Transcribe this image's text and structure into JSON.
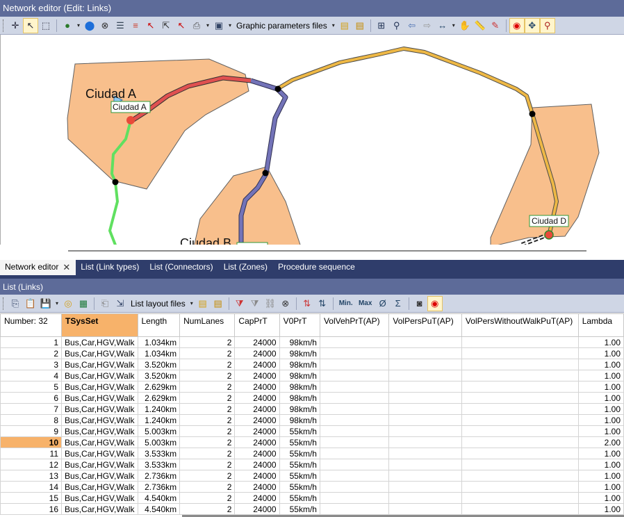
{
  "window": {
    "title": "Network editor (Edit: Links)"
  },
  "toolbar_top": {
    "items": [
      {
        "type": "grip"
      },
      {
        "type": "btn",
        "name": "cross-icon",
        "glyph": "✛"
      },
      {
        "type": "btn",
        "name": "pointer-icon",
        "glyph": "↖",
        "active": true
      },
      {
        "type": "btn",
        "name": "rect-select-icon",
        "glyph": "⬚"
      },
      {
        "type": "sep"
      },
      {
        "type": "btn",
        "name": "globe-icon",
        "glyph": "●",
        "color": "#2b7a2b"
      },
      {
        "type": "drop"
      },
      {
        "type": "btn",
        "name": "map-pin-icon",
        "glyph": "⬤",
        "color": "#1e6fd9"
      },
      {
        "type": "btn",
        "name": "binoculars-icon",
        "glyph": "⊗",
        "color": "#333"
      },
      {
        "type": "btn",
        "name": "list-icon",
        "glyph": "☰",
        "color": "#345"
      },
      {
        "type": "btn",
        "name": "layers-icon",
        "glyph": "≡",
        "color": "#c43"
      },
      {
        "type": "btn",
        "name": "select-red-icon",
        "glyph": "↖",
        "color": "#c00"
      },
      {
        "type": "btn",
        "name": "select-multi-icon",
        "glyph": "⇱",
        "color": "#333"
      },
      {
        "type": "btn",
        "name": "select-path-icon",
        "glyph": "↖",
        "color": "#c00"
      },
      {
        "type": "btn",
        "name": "printer-icon",
        "glyph": "⎙",
        "color": "#555"
      },
      {
        "type": "drop"
      },
      {
        "type": "btn",
        "name": "graphic-params-icon",
        "glyph": "▣",
        "color": "#346"
      },
      {
        "type": "drop"
      },
      {
        "type": "label",
        "bind": "toolbar_top.graphic_params_label"
      },
      {
        "type": "drop"
      },
      {
        "type": "btn",
        "name": "open-folder-icon",
        "glyph": "▤",
        "color": "#d4a017"
      },
      {
        "type": "btn",
        "name": "save-folder-icon",
        "glyph": "▤",
        "color": "#c58a00"
      },
      {
        "type": "sep"
      },
      {
        "type": "btn",
        "name": "zoom-rect-icon",
        "glyph": "⊞",
        "color": "#235"
      },
      {
        "type": "btn",
        "name": "zoom-icon",
        "glyph": "⚲",
        "color": "#235"
      },
      {
        "type": "btn",
        "name": "back-arrow-icon",
        "glyph": "⇦",
        "color": "#4a6fb0"
      },
      {
        "type": "btn",
        "name": "forward-arrow-icon",
        "glyph": "⇨",
        "color": "#999"
      },
      {
        "type": "btn",
        "name": "fit-width-icon",
        "glyph": "↔",
        "color": "#246"
      },
      {
        "type": "drop"
      },
      {
        "type": "btn",
        "name": "hand-pan-icon",
        "glyph": "✋",
        "color": "#333"
      },
      {
        "type": "btn",
        "name": "ruler-icon",
        "glyph": "📏",
        "color": "#a66"
      },
      {
        "type": "btn",
        "name": "pencil-icon",
        "glyph": "✎",
        "color": "#c33"
      },
      {
        "type": "sep"
      },
      {
        "type": "btn",
        "name": "record-icon",
        "glyph": "◉",
        "color": "#d00",
        "active": true
      },
      {
        "type": "btn",
        "name": "network-view-icon",
        "glyph": "✥",
        "color": "#246",
        "active": true
      },
      {
        "type": "btn",
        "name": "zoom-map-icon",
        "glyph": "⚲",
        "color": "#a22",
        "active": true
      }
    ],
    "graphic_params_label": "Graphic parameters files"
  },
  "map": {
    "labels": {
      "zone_a": "Ciudad A",
      "node_a": "Ciudad A",
      "zone_b": "Ciudad B",
      "node_d": "Ciudad D"
    },
    "colors": {
      "zone_fill": "#f8bf8c",
      "zone_stroke": "#606060",
      "link_blue": "#7373b8",
      "link_yellow": "#eeb845",
      "link_green": "#60e060",
      "link_red": "#e05050"
    }
  },
  "tabs": [
    {
      "label": "Network editor",
      "active": true,
      "closable": true
    },
    {
      "label": "List (Link types)"
    },
    {
      "label": "List (Connectors)"
    },
    {
      "label": "List (Zones)"
    },
    {
      "label": "Procedure sequence"
    }
  ],
  "list": {
    "title": "List (Links)",
    "layout_files_label": "List layout files",
    "columns": [
      {
        "label": "Number: 32",
        "width": 89
      },
      {
        "label": "TSysSet",
        "width": 100,
        "selected": true
      },
      {
        "label": "Length",
        "width": 61
      },
      {
        "label": "NumLanes",
        "width": 80
      },
      {
        "label": "CapPrT",
        "width": 65
      },
      {
        "label": "V0PrT",
        "width": 59
      },
      {
        "label": "VolVehPrT(AP)",
        "width": 100
      },
      {
        "label": "VolPersPuT(AP)",
        "width": 105
      },
      {
        "label": "VolPersWithoutWalkPuT(AP)",
        "width": 168
      },
      {
        "label": "Lambda",
        "width": 66
      }
    ],
    "rows": [
      {
        "num": "1",
        "tsys": "Bus,Car,HGV,Walk",
        "length": "1.034km",
        "lanes": "2",
        "cap": "24000",
        "v0": "98km/h",
        "lambda": "1.00"
      },
      {
        "num": "2",
        "tsys": "Bus,Car,HGV,Walk",
        "length": "1.034km",
        "lanes": "2",
        "cap": "24000",
        "v0": "98km/h",
        "lambda": "1.00"
      },
      {
        "num": "3",
        "tsys": "Bus,Car,HGV,Walk",
        "length": "3.520km",
        "lanes": "2",
        "cap": "24000",
        "v0": "98km/h",
        "lambda": "1.00"
      },
      {
        "num": "4",
        "tsys": "Bus,Car,HGV,Walk",
        "length": "3.520km",
        "lanes": "2",
        "cap": "24000",
        "v0": "98km/h",
        "lambda": "1.00"
      },
      {
        "num": "5",
        "tsys": "Bus,Car,HGV,Walk",
        "length": "2.629km",
        "lanes": "2",
        "cap": "24000",
        "v0": "98km/h",
        "lambda": "1.00"
      },
      {
        "num": "6",
        "tsys": "Bus,Car,HGV,Walk",
        "length": "2.629km",
        "lanes": "2",
        "cap": "24000",
        "v0": "98km/h",
        "lambda": "1.00"
      },
      {
        "num": "7",
        "tsys": "Bus,Car,HGV,Walk",
        "length": "1.240km",
        "lanes": "2",
        "cap": "24000",
        "v0": "98km/h",
        "lambda": "1.00"
      },
      {
        "num": "8",
        "tsys": "Bus,Car,HGV,Walk",
        "length": "1.240km",
        "lanes": "2",
        "cap": "24000",
        "v0": "98km/h",
        "lambda": "1.00"
      },
      {
        "num": "9",
        "tsys": "Bus,Car,HGV,Walk",
        "length": "5.003km",
        "lanes": "2",
        "cap": "24000",
        "v0": "55km/h",
        "lambda": "1.00"
      },
      {
        "num": "10",
        "tsys": "Bus,Car,HGV,Walk",
        "length": "5.003km",
        "lanes": "2",
        "cap": "24000",
        "v0": "55km/h",
        "lambda": "2.00",
        "highlight": true
      },
      {
        "num": "11",
        "tsys": "Bus,Car,HGV,Walk",
        "length": "3.533km",
        "lanes": "2",
        "cap": "24000",
        "v0": "55km/h",
        "lambda": "1.00"
      },
      {
        "num": "12",
        "tsys": "Bus,Car,HGV,Walk",
        "length": "3.533km",
        "lanes": "2",
        "cap": "24000",
        "v0": "55km/h",
        "lambda": "1.00"
      },
      {
        "num": "13",
        "tsys": "Bus,Car,HGV,Walk",
        "length": "2.736km",
        "lanes": "2",
        "cap": "24000",
        "v0": "55km/h",
        "lambda": "1.00"
      },
      {
        "num": "14",
        "tsys": "Bus,Car,HGV,Walk",
        "length": "2.736km",
        "lanes": "2",
        "cap": "24000",
        "v0": "55km/h",
        "lambda": "1.00"
      },
      {
        "num": "15",
        "tsys": "Bus,Car,HGV,Walk",
        "length": "4.540km",
        "lanes": "2",
        "cap": "24000",
        "v0": "55km/h",
        "lambda": "1.00"
      },
      {
        "num": "16",
        "tsys": "Bus,Car,HGV,Walk",
        "length": "4.540km",
        "lanes": "2",
        "cap": "24000",
        "v0": "55km/h",
        "lambda": "1.00"
      }
    ]
  },
  "toolbar_list": {
    "items": [
      {
        "type": "grip"
      },
      {
        "type": "btn",
        "name": "copy-icon",
        "glyph": "⎘",
        "color": "#346"
      },
      {
        "type": "btn",
        "name": "paste-icon",
        "glyph": "📋",
        "color": "#b8860b"
      },
      {
        "type": "btn",
        "name": "save-icon",
        "glyph": "💾",
        "color": "#246"
      },
      {
        "type": "drop"
      },
      {
        "type": "btn",
        "name": "database-icon",
        "glyph": "◎",
        "color": "#d4a017"
      },
      {
        "type": "btn",
        "name": "excel-icon",
        "glyph": "▦",
        "color": "#1e7a3a"
      },
      {
        "type": "sep"
      },
      {
        "type": "btn",
        "name": "clipboard-icon",
        "glyph": "⎗",
        "color": "#888"
      },
      {
        "type": "btn",
        "name": "select-columns-icon",
        "glyph": "⇲",
        "color": "#346"
      },
      {
        "type": "label",
        "bind": "list.layout_files_label"
      },
      {
        "type": "drop"
      },
      {
        "type": "btn",
        "name": "open-layout-icon",
        "glyph": "▤",
        "color": "#d4a017"
      },
      {
        "type": "btn",
        "name": "save-layout-icon",
        "glyph": "▤",
        "color": "#c58a00"
      },
      {
        "type": "sep"
      },
      {
        "type": "btn",
        "name": "filter-icon",
        "glyph": "⧩",
        "color": "#c33"
      },
      {
        "type": "btn",
        "name": "filter-off-icon",
        "glyph": "⧩",
        "color": "#888"
      },
      {
        "type": "btn",
        "name": "sync-icon",
        "glyph": "⛓",
        "color": "#888"
      },
      {
        "type": "btn",
        "name": "binoculars-icon",
        "glyph": "⊗",
        "color": "#333"
      },
      {
        "type": "sep"
      },
      {
        "type": "btn",
        "name": "sort-ascending-icon",
        "glyph": "⇅",
        "color": "#c33"
      },
      {
        "type": "btn",
        "name": "sort-descending-icon",
        "glyph": "⇅",
        "color": "#246"
      },
      {
        "type": "sep"
      },
      {
        "type": "btn",
        "name": "min-icon",
        "glyph": "Min.",
        "color": "#246"
      },
      {
        "type": "btn",
        "name": "max-icon",
        "glyph": "Max",
        "color": "#246"
      },
      {
        "type": "btn",
        "name": "average-icon",
        "glyph": "Ø",
        "color": "#246"
      },
      {
        "type": "btn",
        "name": "sum-icon",
        "glyph": "Σ",
        "color": "#246"
      },
      {
        "type": "sep"
      },
      {
        "type": "btn",
        "name": "stop-icon",
        "glyph": "◙",
        "color": "#333"
      },
      {
        "type": "btn",
        "name": "record-icon",
        "glyph": "◉",
        "color": "#d00",
        "active": true
      }
    ]
  }
}
